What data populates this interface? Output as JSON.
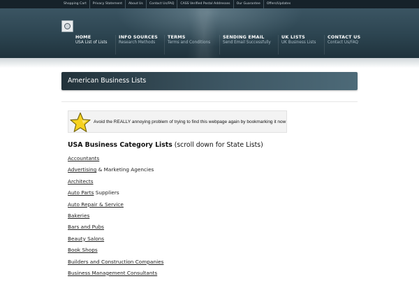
{
  "topbar": {
    "links": [
      "Shopping Cart",
      "Privacy Statement",
      "About Us",
      "Contact Us/FAQ",
      "CASS Verified Postal Addresses",
      "Our Guarantee",
      "Offers/Updates"
    ]
  },
  "nav": [
    {
      "title": "HOME",
      "subtitle": "USA List of Lists",
      "active": true
    },
    {
      "title": "INFO SOURCES",
      "subtitle": "Research Methods",
      "active": false
    },
    {
      "title": "TERMS",
      "subtitle": "Terms and Conditions",
      "active": false
    },
    {
      "title": "SENDING EMAIL",
      "subtitle": "Send Email Successfully",
      "active": false
    },
    {
      "title": "UK LISTS",
      "subtitle": "UK Business Lists",
      "active": false
    },
    {
      "title": "CONTACT US",
      "subtitle": "Contact Us/FAQ",
      "active": false
    }
  ],
  "banner": {
    "title": "American Business Lists"
  },
  "bookmark": {
    "message": "Avoid the REALLY annoying problem of trying to find this webpage again by bookmarking it now",
    "icon": "star-icon"
  },
  "heading": {
    "bold": "USA Business Category Lists",
    "rest": " (scroll down for State Lists)"
  },
  "categories": [
    {
      "link": "Accountants",
      "rest": ""
    },
    {
      "link": "Advertising",
      "rest": " & Marketing Agencies"
    },
    {
      "link": "Architects",
      "rest": ""
    },
    {
      "link": "Auto Parts",
      "rest": " Suppliers"
    },
    {
      "link": "Auto Repair & Service",
      "rest": ""
    },
    {
      "link": "Bakeries",
      "rest": ""
    },
    {
      "link": "Bars and Pubs",
      "rest": ""
    },
    {
      "link": "Beauty Salons",
      "rest": ""
    },
    {
      "link": "Book Shops",
      "rest": ""
    },
    {
      "link": "Builders and Construction Companies",
      "rest": ""
    },
    {
      "link": "Business Management Consultants",
      "rest": ""
    }
  ],
  "colors": {
    "header": "#2c4450",
    "banner": "#3d5663",
    "star": "#f7d21e"
  }
}
